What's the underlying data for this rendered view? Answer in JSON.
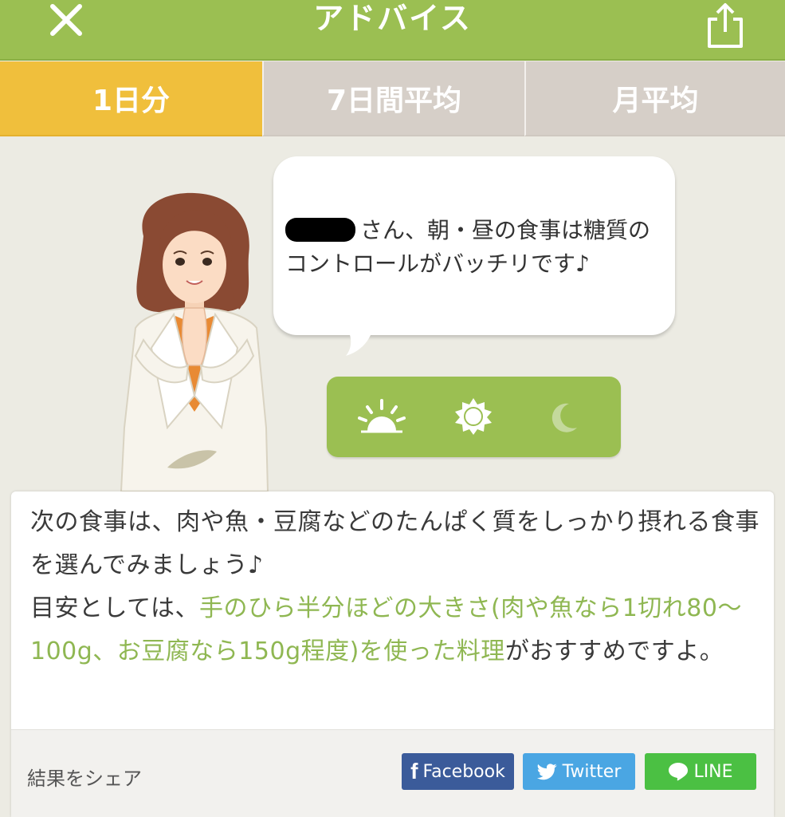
{
  "header": {
    "title": "アドバイス",
    "close_icon": "close-icon",
    "share_icon": "share-upload-icon",
    "background": "#9bbf52"
  },
  "tabs": [
    {
      "label": "1日分",
      "active": true
    },
    {
      "label": "7日間平均",
      "active": false
    },
    {
      "label": "月平均",
      "active": false
    }
  ],
  "colors": {
    "active_tab": "#f0bf3c",
    "inactive_tab": "#d6cfc8",
    "highlight_text": "#8fb752"
  },
  "advisor": {
    "message_suffix": "さん、朝・昼の食事は糖質のコントロールがバッチリです♪"
  },
  "meals": [
    {
      "name": "morning",
      "icon": "sunrise-icon",
      "done": true
    },
    {
      "name": "noon",
      "icon": "sun-icon",
      "done": true
    },
    {
      "name": "night",
      "icon": "moon-icon",
      "done": false
    }
  ],
  "advice": {
    "line1": "次の食事は、肉や魚・豆腐などのたんぱく質をしっかり摂れる食事を選んでみましょう♪",
    "line2_prefix": "目安としては、",
    "line2_highlight": "手のひら半分ほどの大きさ(肉や魚なら1切れ80〜100g、お豆腐なら150g程度)を使った料理",
    "line2_suffix": "がおすすめですよ。"
  },
  "share": {
    "label": "結果をシェア",
    "facebook": "Facebook",
    "twitter": "Twitter",
    "line": "LINE"
  }
}
